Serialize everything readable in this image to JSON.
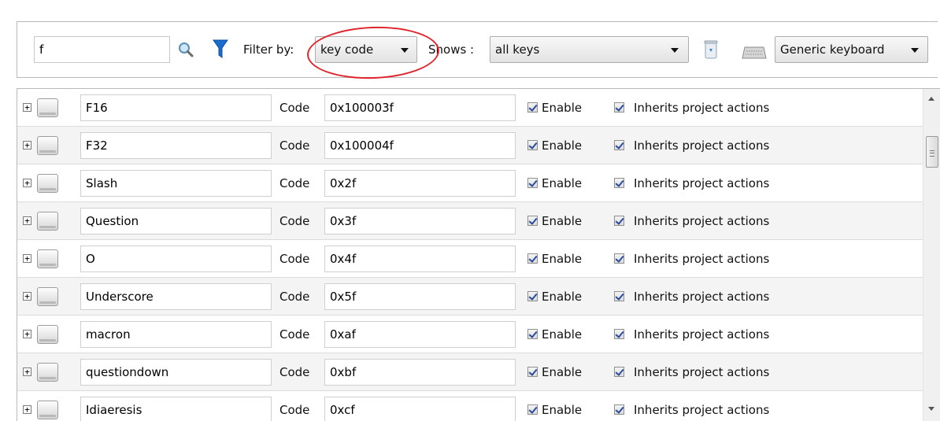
{
  "toolbar": {
    "search_value": "f",
    "search_icon": "magnifier-icon",
    "filter_icon": "funnel-icon",
    "filter_label": "Filter by:",
    "filter_selected": "key code",
    "shows_label": "Shows :",
    "shows_selected": "all keys",
    "clean_icon": "trash-icon",
    "keyboard_icon": "keyboard-icon",
    "keyboard_selected": "Generic keyboard"
  },
  "rows": [
    {
      "name": "F16",
      "code": "0x100003f"
    },
    {
      "name": "F32",
      "code": "0x100004f"
    },
    {
      "name": "Slash",
      "code": "0x2f"
    },
    {
      "name": "Question",
      "code": "0x3f"
    },
    {
      "name": "O",
      "code": "0x4f"
    },
    {
      "name": "Underscore",
      "code": "0x5f"
    },
    {
      "name": "macron",
      "code": "0xaf"
    },
    {
      "name": "questiondown",
      "code": "0xbf"
    },
    {
      "name": "Idiaeresis",
      "code": "0xcf"
    }
  ],
  "row_labels": {
    "code": "Code",
    "enable": "Enable",
    "inherits": "Inherits project actions",
    "expander": "+"
  },
  "colors": {
    "highlight": "#e0232b",
    "filter_funnel": "#1a6ccf",
    "checkmark": "#2a4a9c"
  }
}
